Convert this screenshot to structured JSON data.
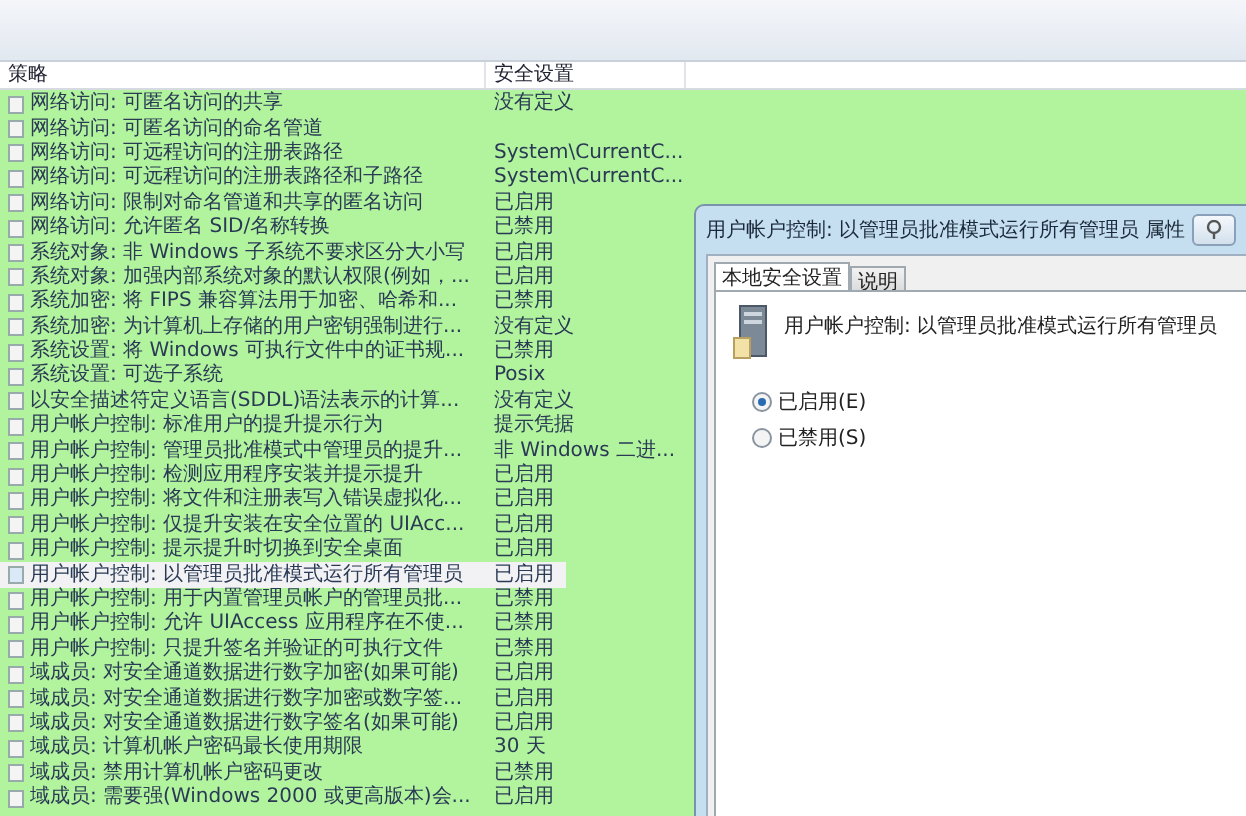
{
  "columns": [
    {
      "label": "策略"
    },
    {
      "label": "安全设置"
    }
  ],
  "rows": [
    {
      "policy": "网络访问: 可匿名访问的共享",
      "setting": "没有定义",
      "selected": false
    },
    {
      "policy": "网络访问: 可匿名访问的命名管道",
      "selected": false
    },
    {
      "policy": "网络访问: 可远程访问的注册表路径",
      "setting": "System\\CurrentC...",
      "selected": false
    },
    {
      "policy": "网络访问: 可远程访问的注册表路径和子路径",
      "setting": "System\\CurrentC...",
      "selected": false
    },
    {
      "policy": "网络访问: 限制对命名管道和共享的匿名访问",
      "setting": "已启用",
      "selected": false
    },
    {
      "policy": "网络访问: 允许匿名 SID/名称转换",
      "setting": "已禁用",
      "selected": false
    },
    {
      "policy": "系统对象: 非 Windows 子系统不要求区分大小写",
      "setting": "已启用",
      "selected": false
    },
    {
      "policy": "系统对象: 加强内部系统对象的默认权限(例如，...",
      "setting": "已启用",
      "selected": false
    },
    {
      "policy": "系统加密: 将 FIPS 兼容算法用于加密、哈希和...",
      "setting": "已禁用",
      "selected": false
    },
    {
      "policy": "系统加密: 为计算机上存储的用户密钥强制进行...",
      "setting": "没有定义",
      "selected": false
    },
    {
      "policy": "系统设置: 将 Windows 可执行文件中的证书规...",
      "setting": "已禁用",
      "selected": false
    },
    {
      "policy": "系统设置: 可选子系统",
      "setting": "Posix",
      "selected": false
    },
    {
      "policy": "以安全描述符定义语言(SDDL)语法表示的计算...",
      "setting": "没有定义",
      "selected": false
    },
    {
      "policy": "用户帐户控制: 标准用户的提升提示行为",
      "setting": "提示凭据",
      "selected": false
    },
    {
      "policy": "用户帐户控制: 管理员批准模式中管理员的提升...",
      "setting": "非 Windows 二进...",
      "selected": false
    },
    {
      "policy": "用户帐户控制: 检测应用程序安装并提示提升",
      "setting": "已启用",
      "selected": false
    },
    {
      "policy": "用户帐户控制: 将文件和注册表写入错误虚拟化...",
      "setting": "已启用",
      "selected": false
    },
    {
      "policy": "用户帐户控制: 仅提升安装在安全位置的 UIAcc...",
      "setting": "已启用",
      "selected": false
    },
    {
      "policy": "用户帐户控制: 提示提升时切换到安全桌面",
      "setting": "已启用",
      "selected": false
    },
    {
      "policy": "用户帐户控制: 以管理员批准模式运行所有管理员",
      "setting": "已启用",
      "selected": true
    },
    {
      "policy": "用户帐户控制: 用于内置管理员帐户的管理员批...",
      "setting": "已禁用",
      "selected": false
    },
    {
      "policy": "用户帐户控制: 允许 UIAccess 应用程序在不使...",
      "setting": "已禁用",
      "selected": false
    },
    {
      "policy": "用户帐户控制: 只提升签名并验证的可执行文件",
      "setting": "已禁用",
      "selected": false
    },
    {
      "policy": "域成员: 对安全通道数据进行数字加密(如果可能)",
      "setting": "已启用",
      "selected": false
    },
    {
      "policy": "域成员: 对安全通道数据进行数字加密或数字签...",
      "setting": "已启用",
      "selected": false
    },
    {
      "policy": "域成员: 对安全通道数据进行数字签名(如果可能)",
      "setting": "已启用",
      "selected": false
    },
    {
      "policy": "域成员: 计算机帐户密码最长使用期限",
      "setting": "30 天",
      "selected": false
    },
    {
      "policy": "域成员: 禁用计算机帐户密码更改",
      "setting": "已禁用",
      "selected": false
    },
    {
      "policy": "域成员: 需要强(Windows 2000 或更高版本)会...",
      "setting": "已启用",
      "selected": false
    }
  ],
  "dialog": {
    "title": "用户帐户控制: 以管理员批准模式运行所有管理员 属性",
    "tabs": [
      {
        "label": "本地安全设置",
        "selected": true
      },
      {
        "label": "说明",
        "selected": false
      }
    ],
    "policy_name": "用户帐户控制: 以管理员批准模式运行所有管理员",
    "options": [
      {
        "label": "已启用(E)",
        "selected": true
      },
      {
        "label": "已禁用(S)",
        "selected": false
      }
    ]
  }
}
